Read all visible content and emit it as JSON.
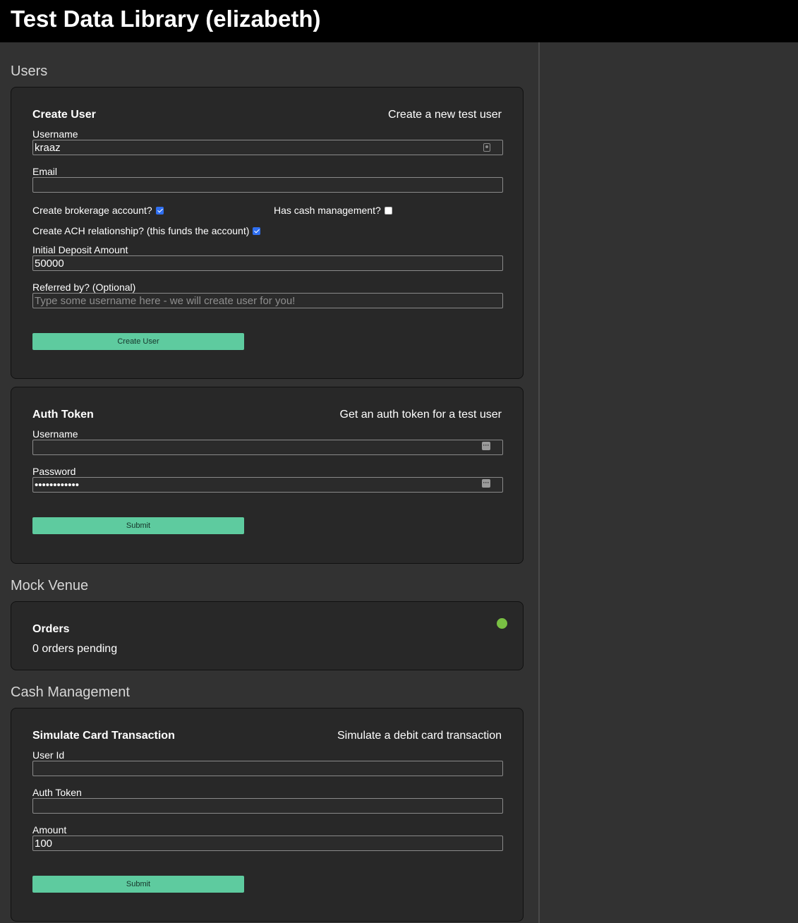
{
  "header": {
    "title": "Test Data Library (elizabeth)"
  },
  "users": {
    "section_title": "Users",
    "create_user": {
      "title": "Create User",
      "description": "Create a new test user",
      "username_label": "Username",
      "username_value": "kraaz",
      "email_label": "Email",
      "email_value": "",
      "brokerage_label": "Create brokerage account?",
      "brokerage_checked": true,
      "cash_mgmt_label": "Has cash management?",
      "cash_mgmt_checked": false,
      "ach_label": "Create ACH relationship? (this funds the account)",
      "ach_checked": true,
      "deposit_label": "Initial Deposit Amount",
      "deposit_value": "50000",
      "referred_label": "Referred by? (Optional)",
      "referred_placeholder": "Type some username here - we will create user for you!",
      "button_label": "Create User"
    },
    "auth_token": {
      "title": "Auth Token",
      "description": "Get an auth token for a test user",
      "username_label": "Username",
      "username_value": "",
      "password_label": "Password",
      "password_value": "passwordpass",
      "button_label": "Submit"
    }
  },
  "mock_venue": {
    "section_title": "Mock Venue",
    "orders": {
      "title": "Orders",
      "pending_text": "0 orders pending",
      "status_color": "#79c043"
    }
  },
  "cash_management": {
    "section_title": "Cash Management",
    "card_txn": {
      "title": "Simulate Card Transaction",
      "description": "Simulate a debit card transaction",
      "user_id_label": "User Id",
      "user_id_value": "",
      "auth_token_label": "Auth Token",
      "auth_token_value": "",
      "amount_label": "Amount",
      "amount_value": "100",
      "button_label": "Submit"
    }
  },
  "colors": {
    "accent": "#5ecb9f",
    "background": "#323232",
    "card": "#282828"
  }
}
